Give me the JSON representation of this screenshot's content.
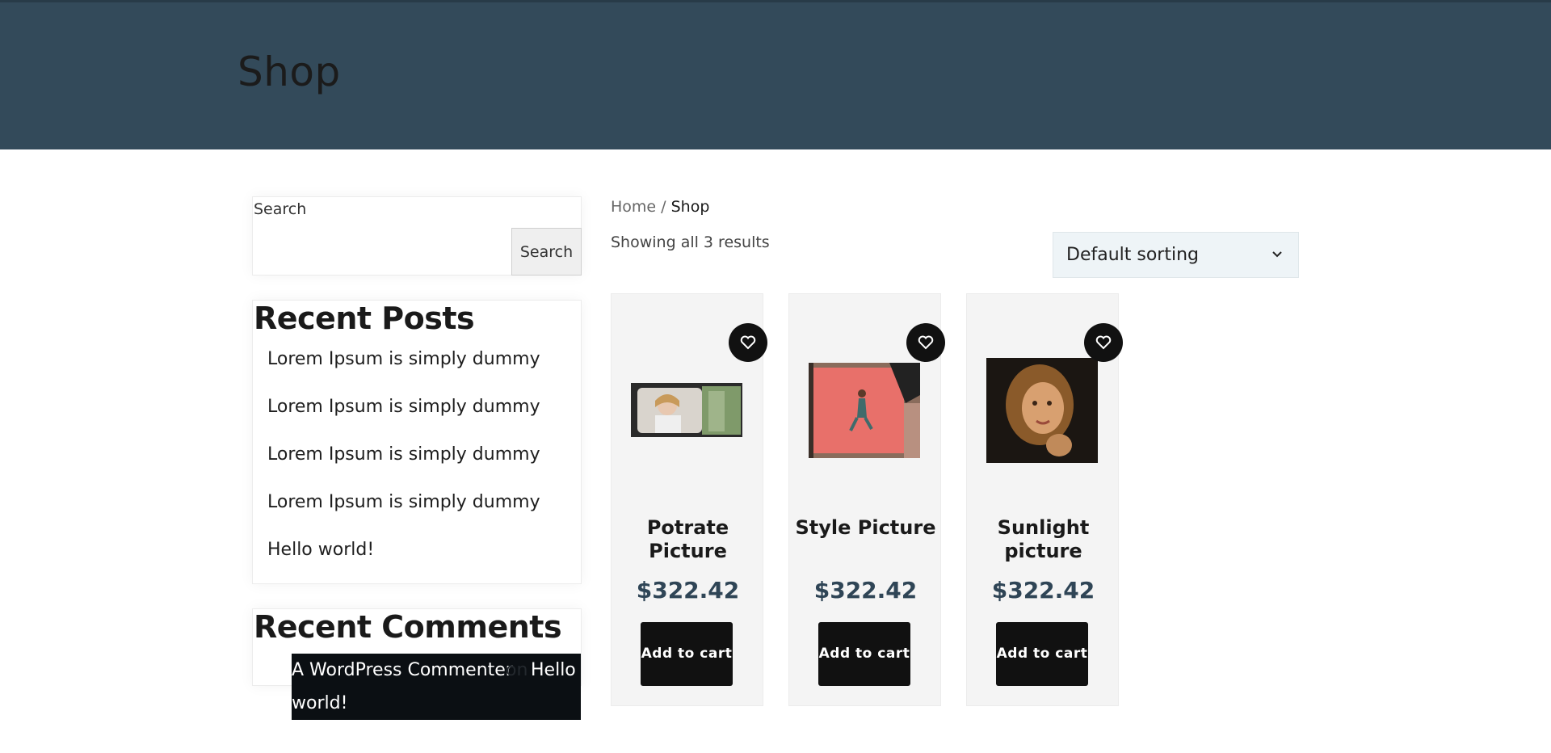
{
  "page": {
    "title": "Shop"
  },
  "sidebar": {
    "search": {
      "label": "Search",
      "button": "Search",
      "value": ""
    },
    "recent_posts": {
      "title": "Recent Posts",
      "items": [
        "Lorem Ipsum is simply dummy",
        "Lorem Ipsum is simply dummy",
        "Lorem Ipsum is simply dummy",
        "Lorem Ipsum is simply dummy",
        "Hello world!"
      ]
    },
    "recent_comments": {
      "title": "Recent Comments",
      "comment": {
        "author": "A WordPress Commenter",
        "on": "on",
        "post_line1": "Hello",
        "post_line2": "world!"
      }
    }
  },
  "breadcrumb": {
    "home": "Home",
    "separator": " / ",
    "current": "Shop"
  },
  "results_text": "Showing all 3 results",
  "sorting": {
    "selected": "Default sorting"
  },
  "products": [
    {
      "name": "Potrate Picture",
      "price": "$322.42",
      "cart_label": "Add to cart"
    },
    {
      "name": "Style Picture",
      "price": "$322.42",
      "cart_label": "Add to cart"
    },
    {
      "name": "Sunlight picture",
      "price": "$322.42",
      "cart_label": "Add to cart"
    }
  ],
  "icons": {
    "wishlist": "heart-icon",
    "dropdown": "chevron-down-icon"
  },
  "colors": {
    "header_bg": "#334a5a",
    "button_bg": "#111111",
    "price": "#2f4556",
    "card_bg": "#f4f4f4"
  }
}
